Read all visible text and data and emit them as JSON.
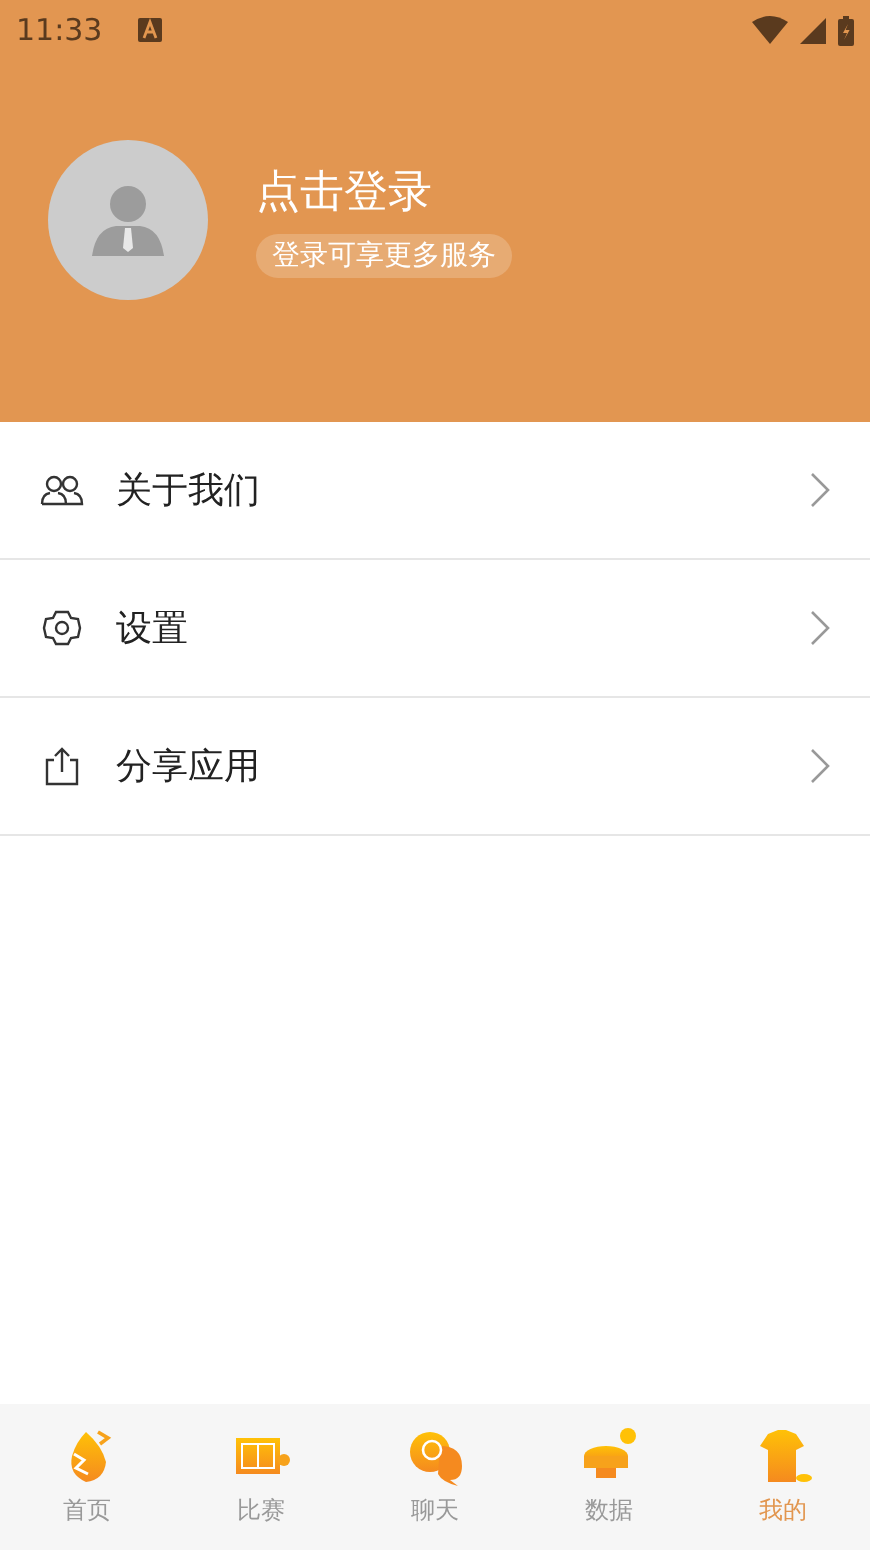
{
  "status_bar": {
    "time": "11:33"
  },
  "profile": {
    "title": "点击登录",
    "subtitle": "登录可享更多服务"
  },
  "menu": [
    {
      "label": "关于我们",
      "kind": "people"
    },
    {
      "label": "设置",
      "kind": "settings"
    },
    {
      "label": "分享应用",
      "kind": "share"
    }
  ],
  "tab_bar": [
    {
      "label": "首页",
      "selected": false
    },
    {
      "label": "比赛",
      "selected": false
    },
    {
      "label": "聊天",
      "selected": false
    },
    {
      "label": "数据",
      "selected": false
    },
    {
      "label": "我的",
      "selected": true
    }
  ]
}
